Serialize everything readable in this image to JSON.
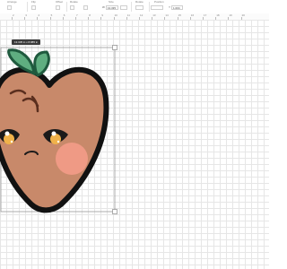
{
  "toolbar": {
    "groups": [
      {
        "name": "arrange",
        "label": "Arrange",
        "value": "",
        "key": ""
      },
      {
        "name": "flip",
        "label": "Flip",
        "value": "",
        "key": ""
      },
      {
        "name": "offset",
        "label": "Offset",
        "value": "",
        "key": ""
      },
      {
        "name": "rotate",
        "label": "Rotate",
        "value": "",
        "key": ""
      },
      {
        "name": "position-x",
        "label": "",
        "value": "",
        "key": ""
      },
      {
        "name": "size",
        "label": "Size",
        "value": "13.335",
        "key": "W"
      },
      {
        "name": "rotate-angle",
        "label": "Rotate",
        "value": "",
        "key": ""
      },
      {
        "name": "position",
        "label": "Position",
        "value": "1.004",
        "key": "Y"
      }
    ]
  },
  "ruler": {
    "numbers": [
      "2",
      "3",
      "4",
      "5",
      "6",
      "7",
      "8",
      "9",
      "10",
      "11",
      "12",
      "13",
      "14",
      "15",
      "16",
      "17",
      "18",
      "19",
      "20"
    ]
  },
  "selection": {
    "size_label": "13.335 in x 8.885 in"
  },
  "colors": {
    "grid": "#e6e6e6",
    "peach_body": "#c8896a",
    "outline": "#111111",
    "leaf": "#5fae80",
    "leaf_dark": "#1f5a3e",
    "cheek": "#ef9a85",
    "eye_iris": "#f0b24a"
  }
}
